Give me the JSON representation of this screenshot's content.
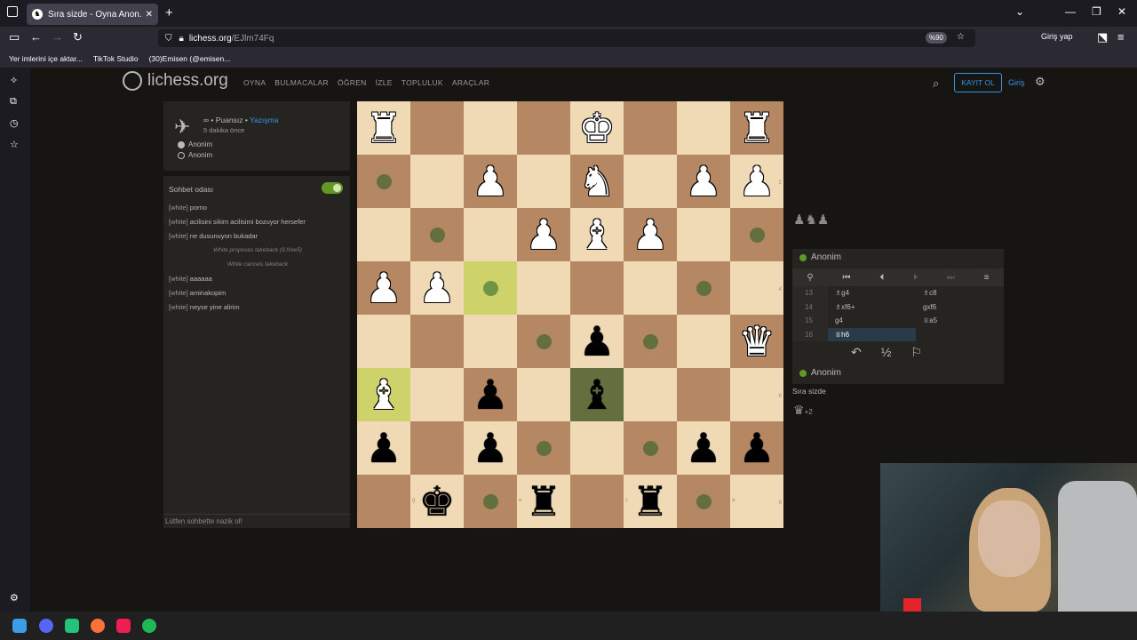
{
  "browser": {
    "tab_title": "Sıra sizde - Oyna Anon. • liches",
    "url_host": "lichess.org",
    "url_path": "/EJlm74Fq",
    "zoom": "%90",
    "login": "Giriş yap"
  },
  "bookmarks": [
    "Yer imlerini içe aktar...",
    "TikTok Studio",
    "(30)Emisen (@emisen..."
  ],
  "lichess": {
    "logo": "lichess.org",
    "menu": [
      "OYNA",
      "BULMACALAR",
      "ÖĞREN",
      "İZLE",
      "TOPLULUK",
      "ARAÇLAR"
    ],
    "signup": "KAYIT OL",
    "signin": "Giriş"
  },
  "game": {
    "type_prefix": "∞ • Puansız •",
    "type_link": "Yazışma",
    "when": "5 dakika önce",
    "white": "Anonim",
    "black": "Anonim"
  },
  "chat": {
    "title": "Sohbet odası",
    "messages": [
      {
        "user": "[white]",
        "text": "porno"
      },
      {
        "user": "[white]",
        "text": "acilisini sikim acilisimi bozuyor hersefer"
      },
      {
        "user": "[white]",
        "text": "ne dusunuyon bukadar"
      },
      {
        "system": "White proposes takeback (9.Nxe5)"
      },
      {
        "system": "White cancels takeback"
      },
      {
        "user": "[white]",
        "text": "aaaaaa"
      },
      {
        "user": "[white]",
        "text": "aminakopim"
      },
      {
        "user": "[white]",
        "text": "neyse yine alirim"
      }
    ],
    "input_placeholder": "Lütfen sohbette nazik ol!"
  },
  "board": {
    "ranks": [
      "1",
      "2",
      "3",
      "4",
      "5",
      "6",
      "7",
      "8"
    ],
    "files": [
      "h",
      "g",
      "f",
      "e",
      "d",
      "c",
      "b",
      "a"
    ]
  },
  "right_panel": {
    "captured_top": "♟♞♟",
    "opponent": "Anonim",
    "player": "Anonim",
    "moves": [
      {
        "no": "13",
        "white": "♗g4",
        "black": "♗c8"
      },
      {
        "no": "14",
        "white": "♗xf6+",
        "black": "gxf6"
      },
      {
        "no": "15",
        "white": "g4",
        "black": "♕a5"
      },
      {
        "no": "16",
        "white": "♕h6",
        "black": ""
      }
    ],
    "turn": "Sıra sizde",
    "captured_bottom": "♛",
    "material": "+2"
  },
  "colors": {
    "bg": "#161512",
    "panel": "#262421",
    "light_square": "#f0d9b5",
    "dark_square": "#b58863",
    "accent_blue": "#3692e7",
    "green": "#629924"
  }
}
